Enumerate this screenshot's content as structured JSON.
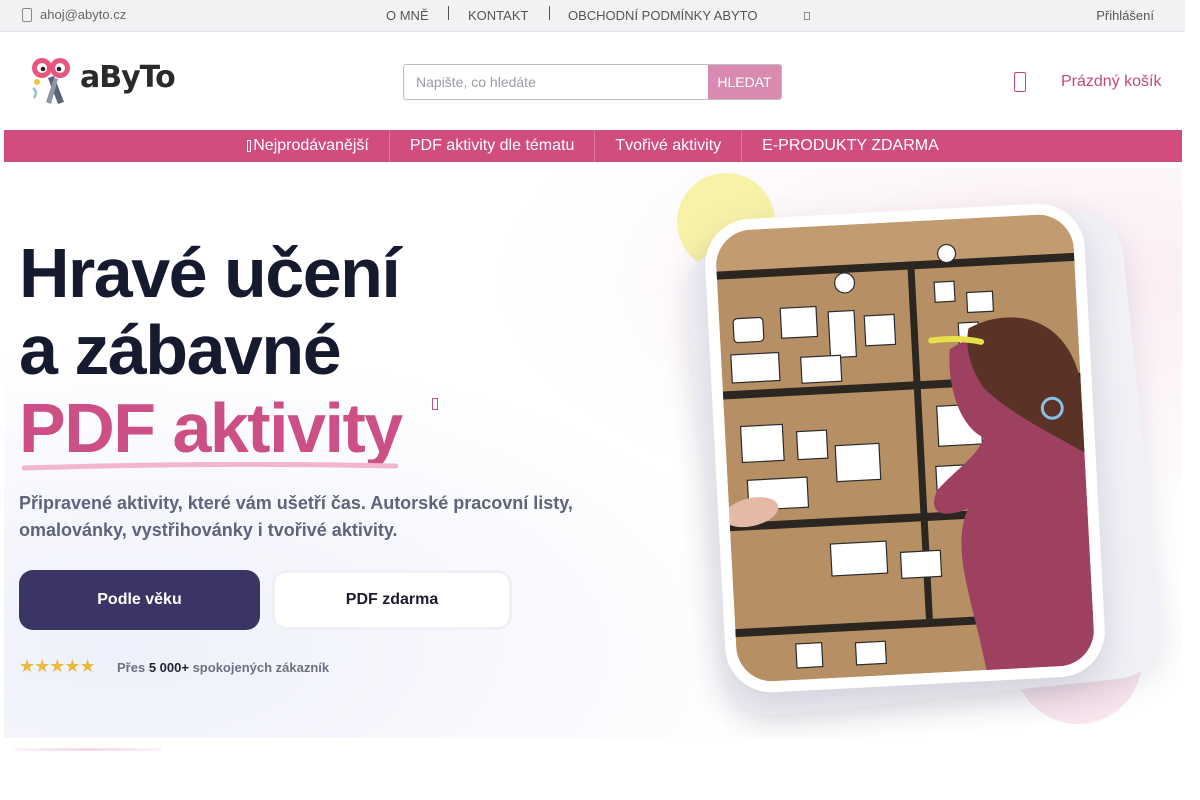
{
  "topbar": {
    "email": "ahoj@abyto.cz",
    "links": [
      "O MNĚ",
      "KONTAKT",
      "OBCHODNÍ PODMÍNKY ABYTO"
    ],
    "login": "Přihlášení"
  },
  "header": {
    "logo_text": "aByTo",
    "search_placeholder": "Napište, co hledáte",
    "search_button": "HLEDAT",
    "cart": "Prázdný košík"
  },
  "mainnav": {
    "items": [
      "Nejprodávanější",
      "PDF aktivity dle tématu",
      "Tvořivé aktivity",
      "E-PRODUKTY ZDARMA"
    ]
  },
  "hero": {
    "title_line1": "Hravé učení",
    "title_line2": "a zábavné",
    "title_line3": "PDF aktivity",
    "lead": "Připravené aktivity, které vám ušetří čas. Autorské pracovní listy, omalovánky, vystřihovánky i tvořivé aktivity.",
    "btn_primary": "Podle věku",
    "btn_secondary": "PDF zdarma",
    "stars": "★★★★★",
    "social_prefix": "Přes",
    "social_count": "5 000+",
    "social_suffix": "spokojených zákazník"
  },
  "colors": {
    "brand_pink": "#d24d7f",
    "dark_navy": "#3b3566",
    "heading": "#151a2e",
    "star_gold": "#ecb93c"
  },
  "icons": [
    "envelope-icon",
    "info-icon",
    "cart-icon",
    "star-icon",
    "sparkle-icon"
  ]
}
